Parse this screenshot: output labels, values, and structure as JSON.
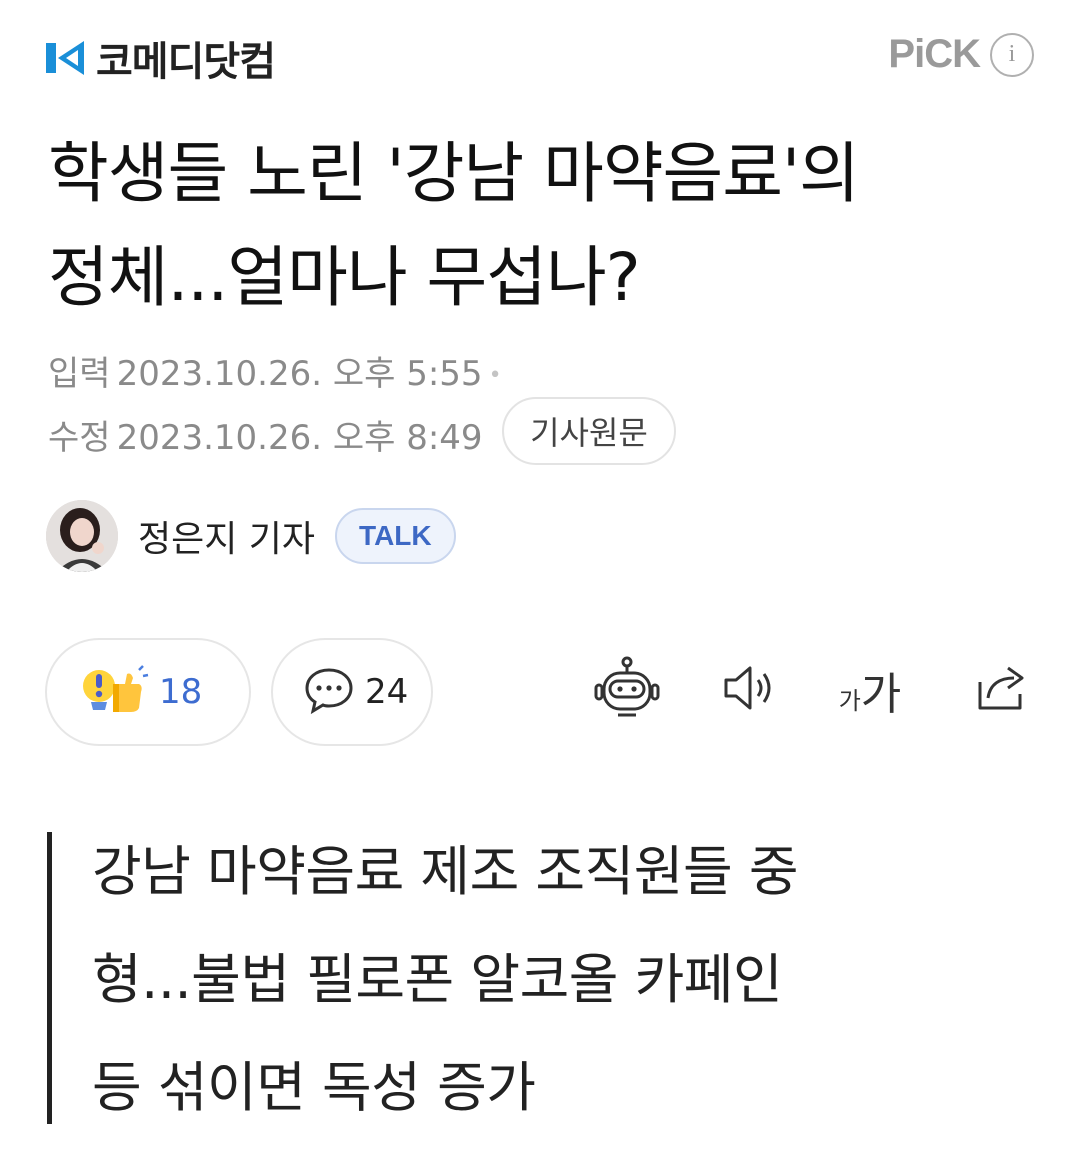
{
  "header": {
    "logo_text": "코메디닷컴",
    "pick_label": "PiCK",
    "pick_info_glyph": "i",
    "brand_color": "#1a8fd8"
  },
  "article": {
    "headline_line1": "학생들 노린 '강남 마약음료'의",
    "headline_line2": "정체...얼마나 무섭나?",
    "published_label": "입력",
    "published_value": "2023.10.26. 오후 5:55",
    "modified_label": "수정",
    "modified_value": "2023.10.26. 오후 8:49",
    "origin_button": "기사원문",
    "reporter_name": "정은지 기자",
    "talk_badge": "TALK",
    "subheadline_line1": "강남 마약음료 제조 조직원들 중",
    "subheadline_line2": "형...불법 필로폰 알코올 카페인",
    "subheadline_line3": "등 섞이면 독성 증가"
  },
  "actions": {
    "reaction_count": "18",
    "comment_count": "24",
    "font_small": "가",
    "font_big": "가",
    "icons": [
      "reaction-icon",
      "comment-icon",
      "robot-summary-icon",
      "speaker-icon",
      "font-size-icon",
      "share-icon"
    ]
  }
}
